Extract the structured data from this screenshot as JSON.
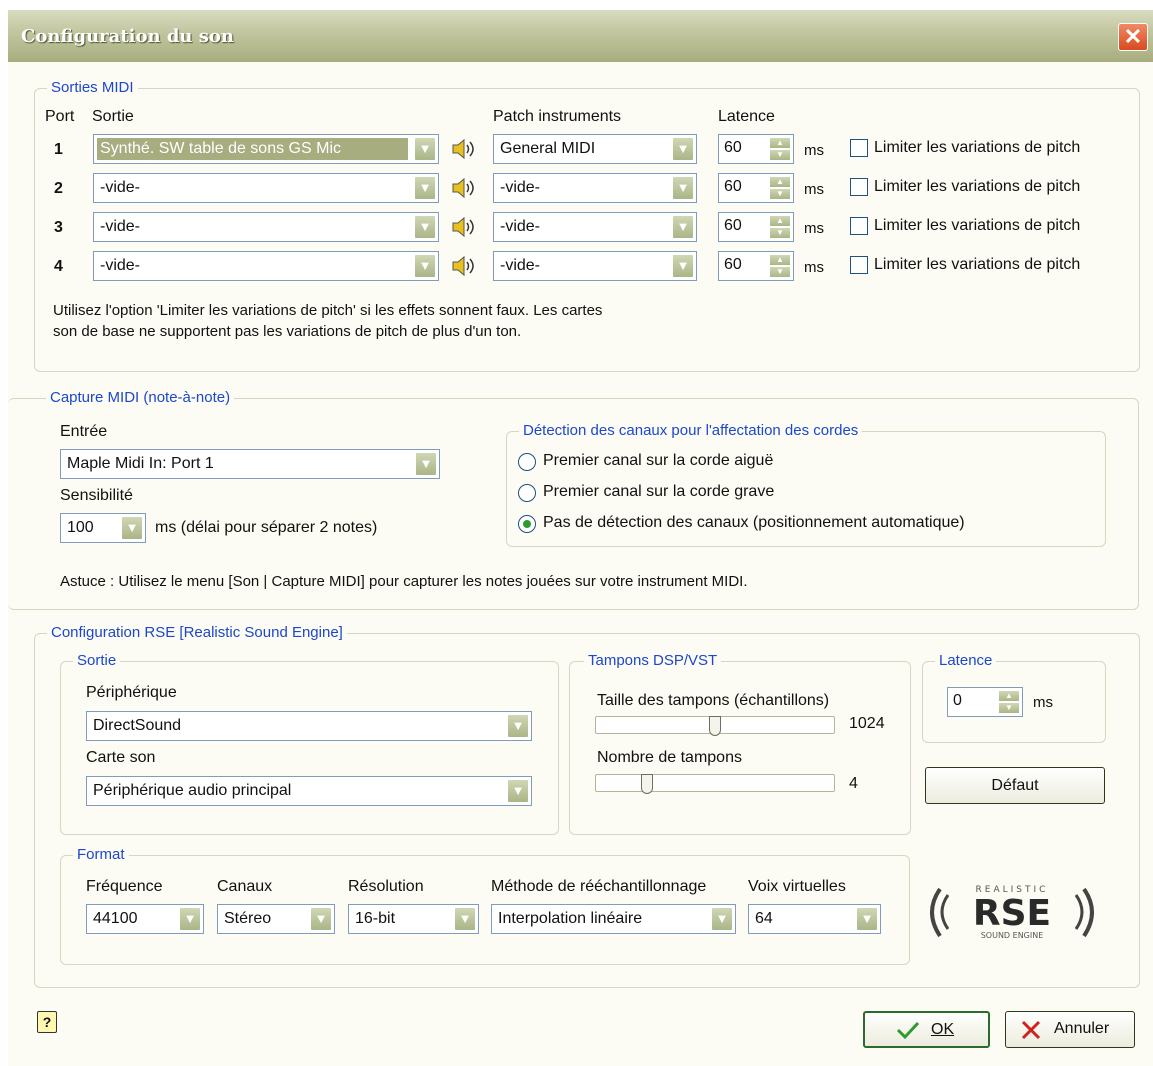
{
  "window": {
    "title": "Configuration du son"
  },
  "midi_out": {
    "legend": "Sorties MIDI",
    "headers": {
      "port": "Port",
      "sortie": "Sortie",
      "patch": "Patch instruments",
      "latence": "Latence"
    },
    "rows": [
      {
        "port": "1",
        "sortie": "Synthé. SW table de sons GS Mic",
        "patch": "General MIDI",
        "latence": "60",
        "unit": "ms",
        "limit_label": "Limiter les variations de pitch",
        "limit_checked": false
      },
      {
        "port": "2",
        "sortie": "-vide-",
        "patch": "-vide-",
        "latence": "60",
        "unit": "ms",
        "limit_label": "Limiter les variations de pitch",
        "limit_checked": false
      },
      {
        "port": "3",
        "sortie": "-vide-",
        "patch": "-vide-",
        "latence": "60",
        "unit": "ms",
        "limit_label": "Limiter les variations de pitch",
        "limit_checked": false
      },
      {
        "port": "4",
        "sortie": "-vide-",
        "patch": "-vide-",
        "latence": "60",
        "unit": "ms",
        "limit_label": "Limiter les variations de pitch",
        "limit_checked": false
      }
    ],
    "note_line1": "Utilisez l'option 'Limiter les variations de pitch' si les effets sonnent faux. Les cartes",
    "note_line2": "son de base ne supportent pas les variations de pitch de plus d'un ton."
  },
  "capture": {
    "legend": "Capture MIDI (note-à-note)",
    "entree_label": "Entrée",
    "entree_value": "Maple Midi In: Port 1",
    "sensibilite_label": "Sensibilité",
    "sensibilite_value": "100",
    "sensibilite_unit": "ms  (délai pour séparer 2 notes)",
    "detection": {
      "legend": "Détection des canaux pour l'affectation des cordes",
      "options": [
        {
          "label": "Premier canal sur la corde aiguë",
          "selected": false
        },
        {
          "label": "Premier canal sur la corde grave",
          "selected": false
        },
        {
          "label": "Pas de détection des canaux (positionnement automatique)",
          "selected": true
        }
      ]
    },
    "tip": "Astuce : Utilisez le menu [Son | Capture MIDI] pour capturer les notes jouées sur votre instrument MIDI."
  },
  "rse": {
    "legend": "Configuration RSE [Realistic Sound Engine]",
    "sortie": {
      "legend": "Sortie",
      "peripherique_label": "Périphérique",
      "peripherique_value": "DirectSound",
      "carte_label": "Carte son",
      "carte_value": "Périphérique audio principal"
    },
    "tampons": {
      "legend": "Tampons DSP/VST",
      "taille_label": "Taille des tampons (échantillons)",
      "taille_value": "1024",
      "taille_fraction": 0.5,
      "nombre_label": "Nombre de tampons",
      "nombre_value": "4",
      "nombre_fraction": 0.2
    },
    "latence": {
      "legend": "Latence",
      "value": "0",
      "unit": "ms"
    },
    "defaut_label": "Défaut",
    "format": {
      "legend": "Format",
      "frequence_label": "Fréquence",
      "frequence_value": "44100",
      "canaux_label": "Canaux",
      "canaux_value": "Stéreo",
      "resolution_label": "Résolution",
      "resolution_value": "16-bit",
      "methode_label": "Méthode de rééchantillonnage",
      "methode_value": "Interpolation linéaire",
      "voix_label": "Voix virtuelles",
      "voix_value": "64"
    },
    "logo": {
      "top": "REALISTIC",
      "main": "RSE",
      "bottom": "SOUND ENGINE"
    }
  },
  "buttons": {
    "ok": "OK",
    "cancel": "Annuler"
  },
  "colors": {
    "title_bar": "#a7ad7e",
    "legend": "#1d47cc",
    "ok_check": "#2e9b2e",
    "cancel_x": "#d12020"
  },
  "icons": {
    "speaker": "speaker-icon",
    "help": "help-icon",
    "close": "close-icon"
  }
}
